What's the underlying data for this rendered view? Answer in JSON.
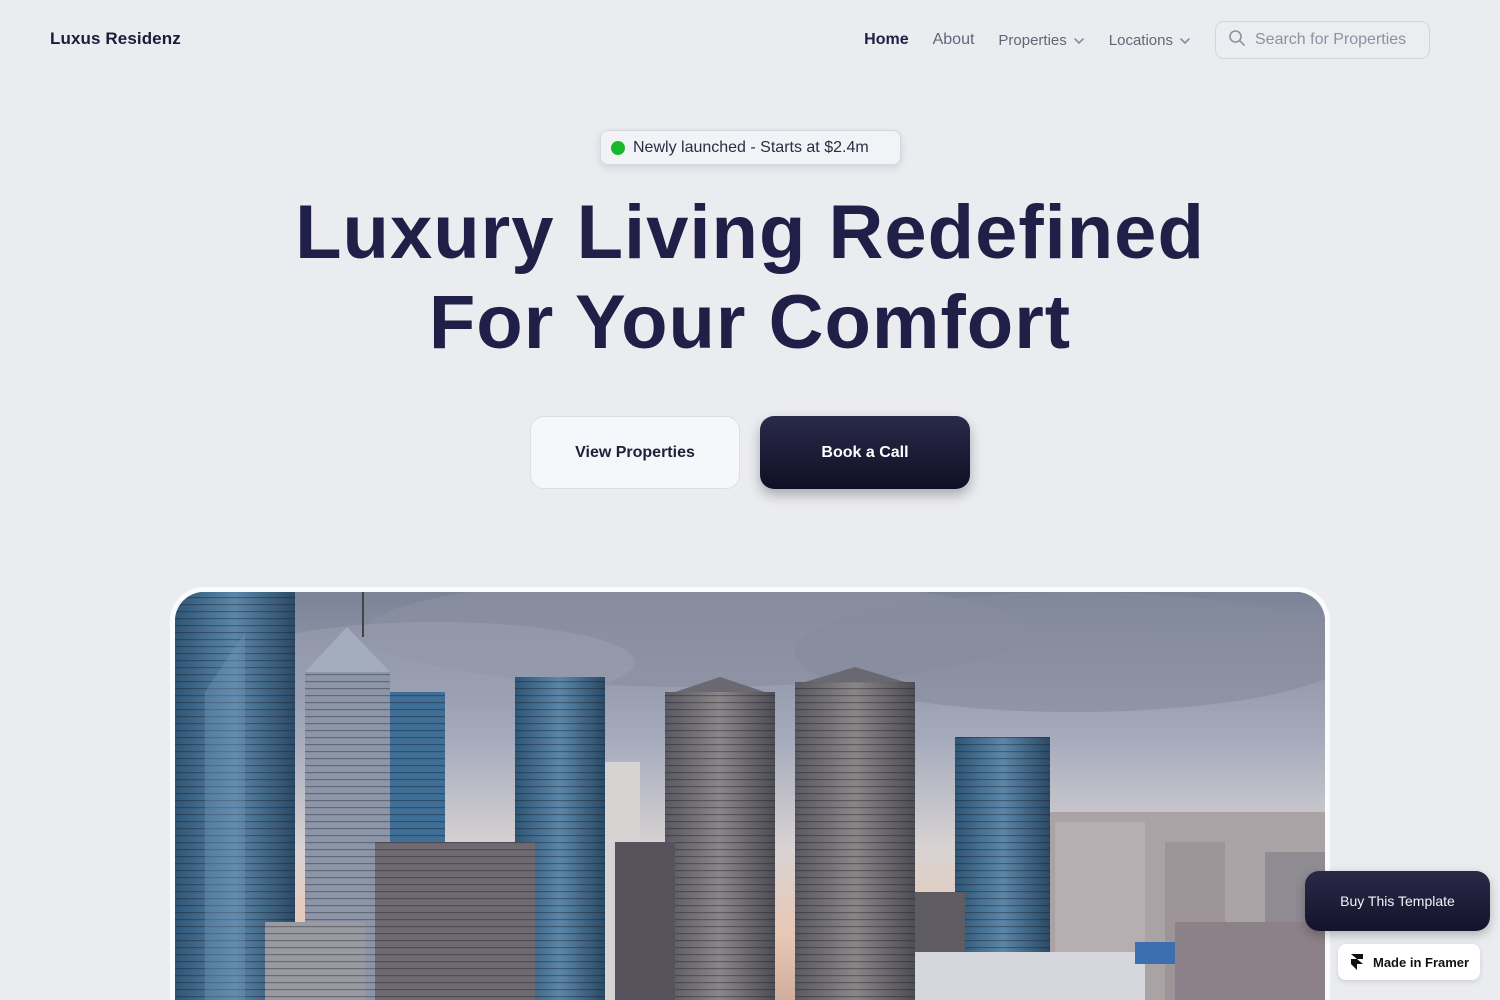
{
  "nav": {
    "brand": "Luxus Residenz",
    "links": [
      {
        "label": "Home"
      },
      {
        "label": "About"
      },
      {
        "label": "Properties"
      },
      {
        "label": "Locations"
      }
    ],
    "search": {
      "placeholder": "Search for Properties",
      "icon": "search-icon"
    }
  },
  "hero": {
    "badge": {
      "text": "Newly launched - Starts at $2.4m",
      "dot_color": "#18b82c"
    },
    "headline_line1": "Luxury Living Redefined",
    "headline_line2": "For Your Comfort",
    "primary_button": "View Properties",
    "secondary_button": "Book a Call"
  },
  "floating": {
    "buy_template": "Buy This Template",
    "made_in_framer": "Made in Framer"
  },
  "colors": {
    "background": "#ebecf0",
    "heading": "#1f1f47",
    "dark_button": "#1a1a35"
  }
}
